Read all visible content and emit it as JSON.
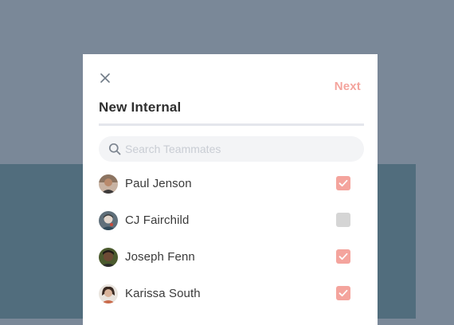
{
  "modal": {
    "title": "New Internal",
    "next_label": "Next",
    "close_icon": "close-icon"
  },
  "search": {
    "placeholder": "Search Teammates",
    "value": "",
    "icon": "search-icon"
  },
  "teammates": [
    {
      "name": "Paul Jenson",
      "checked": true
    },
    {
      "name": "CJ Fairchild",
      "checked": false
    },
    {
      "name": "Joseph Fenn",
      "checked": true
    },
    {
      "name": "Karissa South",
      "checked": true
    }
  ],
  "colors": {
    "accent": "#f4a49d",
    "unchecked": "#d5d5d5",
    "page_background": "#7a8898",
    "band_background": "#516d7d"
  }
}
